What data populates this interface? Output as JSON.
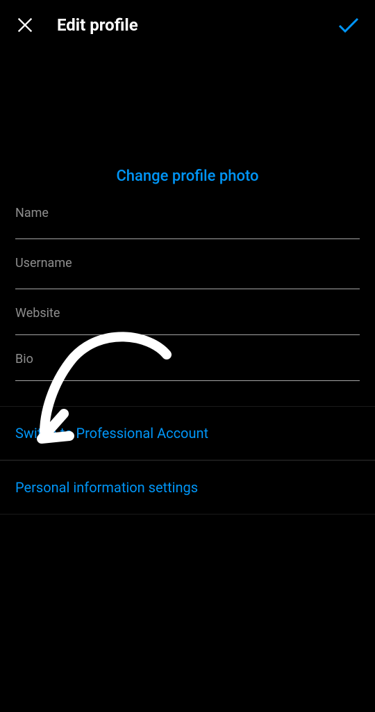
{
  "header": {
    "title": "Edit profile"
  },
  "photo": {
    "change_label": "Change profile photo"
  },
  "fields": {
    "name_label": "Name",
    "username_label": "Username",
    "website_label": "Website",
    "bio_label": "Bio"
  },
  "links": {
    "switch_professional": "Switch to Professional Account",
    "personal_info": "Personal information settings"
  }
}
